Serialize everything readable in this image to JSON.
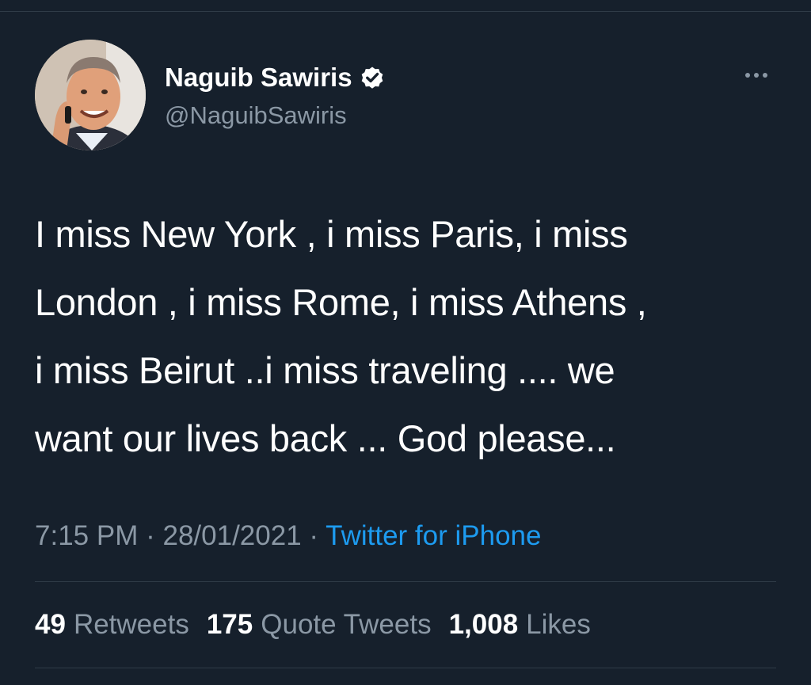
{
  "author": {
    "display_name": "Naguib Sawiris",
    "handle": "@NaguibSawiris",
    "verified": true,
    "avatar_icon": "profile-photo"
  },
  "tweet": {
    "text_lines": [
      "I miss New York , i miss Paris, i miss",
      "London , i miss Rome, i miss Athens ,",
      "i miss Beirut ..i miss traveling .... we",
      "want our lives back ... God please..."
    ]
  },
  "meta": {
    "time": "7:15 PM",
    "separator": "·",
    "date": "28/01/2021",
    "source": "Twitter for iPhone"
  },
  "stats": {
    "retweets_count": "49",
    "retweets_label": "Retweets",
    "quotes_count": "175",
    "quotes_label": "Quote Tweets",
    "likes_count": "1,008",
    "likes_label": "Likes"
  },
  "colors": {
    "background": "#16202c",
    "secondary_text": "#8b98a5",
    "link": "#1d9bf0",
    "divider": "#2f3b47"
  }
}
